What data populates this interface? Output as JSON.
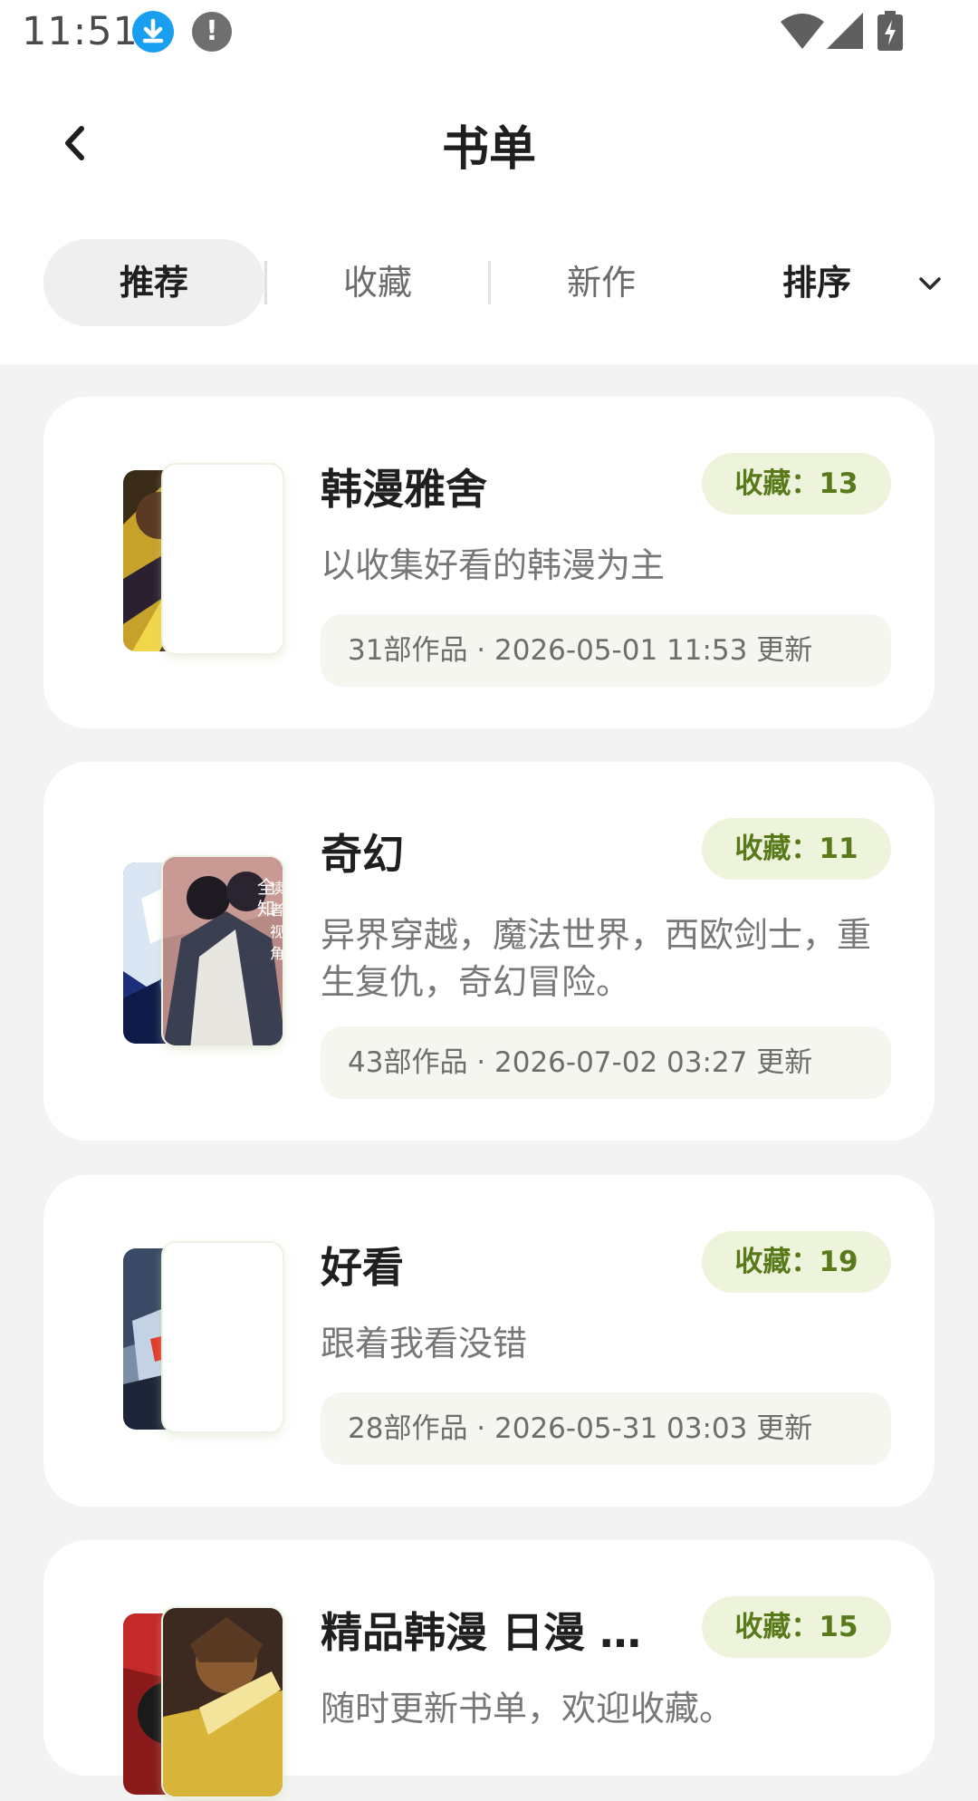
{
  "status_bar": {
    "time": "11:51",
    "alert_glyph": "!",
    "icons": [
      "download-icon",
      "alert-icon",
      "wifi-icon",
      "signal-icon",
      "battery-charging-icon"
    ]
  },
  "header": {
    "title": "书单",
    "back_icon": "chevron-left-icon"
  },
  "tabs": {
    "items": [
      {
        "label": "推荐",
        "active": true
      },
      {
        "label": "收藏",
        "active": false
      },
      {
        "label": "新作",
        "active": false
      }
    ],
    "sort_label": "排序",
    "sort_icon": "chevron-down-icon"
  },
  "colors": {
    "accent_green": "#587a1b",
    "badge_bg": "#eef4dc",
    "meta_bg": "#f5f6f0"
  },
  "booklists": [
    {
      "title": "韩漫雅舍",
      "favorites": "收藏：13",
      "description": "以收集好看的韩漫为主",
      "meta": "31部作品 · 2026-05-01 11:53 更新"
    },
    {
      "title": "奇幻",
      "favorites": "收藏：11",
      "description": "异界穿越，魔法世界，西欧剑士，重生复仇，奇幻冒险。",
      "meta": "43部作品 · 2026-07-02 03:27 更新",
      "cover_text": "全知读者视角"
    },
    {
      "title": "好看",
      "favorites": "收藏：19",
      "description": "跟着我看没错",
      "meta": "28部作品 · 2026-05-31 03:03 更新"
    },
    {
      "title": "精品韩漫 日漫 国…",
      "favorites": "收藏：15",
      "description": "随时更新书单，欢迎收藏。"
    }
  ]
}
